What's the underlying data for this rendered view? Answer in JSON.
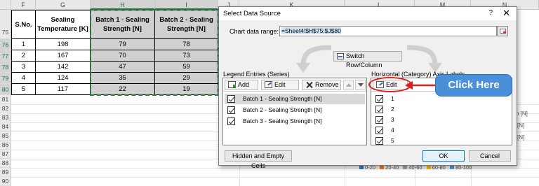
{
  "spreadsheet": {
    "columns": [
      "F",
      "G",
      "H",
      "I",
      "J",
      "K",
      "L",
      "M",
      "N"
    ],
    "header_row": "75",
    "headers": [
      "S.No.",
      "Sealing Temperature [K]",
      "Batch 1 - Sealing Strength [N]",
      "Batch 2 - Sealing Strength [N]"
    ],
    "rows": [
      {
        "num": "76",
        "cells": [
          "1",
          "198",
          "79",
          "78"
        ]
      },
      {
        "num": "77",
        "cells": [
          "2",
          "167",
          "70",
          "73"
        ]
      },
      {
        "num": "78",
        "cells": [
          "3",
          "142",
          "47",
          "59"
        ]
      },
      {
        "num": "79",
        "cells": [
          "4",
          "124",
          "35",
          "29"
        ]
      },
      {
        "num": "80",
        "cells": [
          "5",
          "117",
          "22",
          "19"
        ]
      }
    ],
    "empty_rows": [
      "81",
      "82",
      "83",
      "84",
      "85",
      "86",
      "87",
      "88",
      "89",
      "90"
    ]
  },
  "chart_behind": {
    "fragments": [
      "h [N]",
      "[N]",
      "[N]"
    ],
    "legend": [
      {
        "label": "0-20",
        "color": "#4472c4"
      },
      {
        "label": "20-40",
        "color": "#ed7d31"
      },
      {
        "label": "40-60",
        "color": "#a5a5a5"
      },
      {
        "label": "60-80",
        "color": "#ffc000"
      },
      {
        "label": "80-100",
        "color": "#5b9bd5"
      }
    ]
  },
  "dialog": {
    "title": "Select Data Source",
    "help": "?",
    "close": "✕",
    "range_label": "Chart data range:",
    "range_value": "=Sheet4!$H$75:$J$80",
    "switch_label": "Switch Row/Column",
    "legend_group_label": "Legend Entries (Series)",
    "axis_group_label": "Horizontal (Category) Axis Labels",
    "add_label": "Add",
    "edit_label": "Edit",
    "remove_label": "Remove",
    "series": [
      "Batch 1 - Sealing Strength [N]",
      "Batch 2 - Sealing Strength [N]",
      "Batch 3 - Sealing Strength [N]"
    ],
    "axis_edit_label": "Edit",
    "axis_labels": [
      "1",
      "2",
      "3",
      "4",
      "5"
    ],
    "hidden_cells_label": "Hidden and Empty Cells",
    "ok_label": "OK",
    "cancel_label": "Cancel"
  },
  "callout": {
    "text": "Click Here",
    "color": "#4a90d9",
    "ring_color": "#e01b1b"
  }
}
